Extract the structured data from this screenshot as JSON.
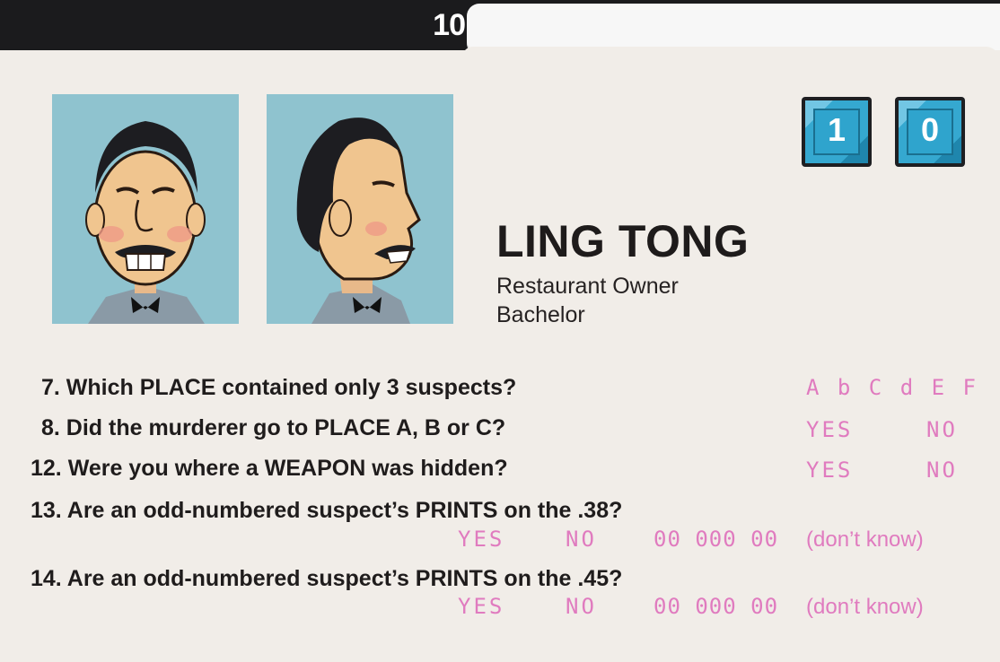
{
  "card": {
    "tab_number": "10",
    "digits": [
      "1",
      "0"
    ],
    "name": "LING TONG",
    "occupation": "Restaurant Owner",
    "status": "Bachelor"
  },
  "questions": [
    {
      "text": "7. Which PLACE contained only 3 suspects?",
      "answers": [
        "A b C d E F"
      ]
    },
    {
      "text": "8. Did the murderer go to PLACE A, B or C?",
      "answers": [
        "YES",
        "NO"
      ]
    },
    {
      "text": "12. Were you where a WEAPON was hidden?",
      "answers": [
        "YES",
        "NO"
      ]
    },
    {
      "text": "13. Are an odd-numbered suspect’s PRINTS on the .38?",
      "answers": [
        "YES",
        "NO",
        "00 000 00",
        "(don’t know)"
      ]
    },
    {
      "text": "14. Are an odd-numbered suspect’s PRINTS on the .45?",
      "answers": [
        "YES",
        "NO",
        "00 000 00",
        "(don’t know)"
      ]
    }
  ],
  "colors": {
    "card_background": "#f1ede8",
    "answer_pink": "#e07bbf",
    "digit_blue": "#35a8d0",
    "portrait_background": "#8fc3cf"
  },
  "icons": [
    "portrait-front-illustration",
    "portrait-side-illustration"
  ]
}
